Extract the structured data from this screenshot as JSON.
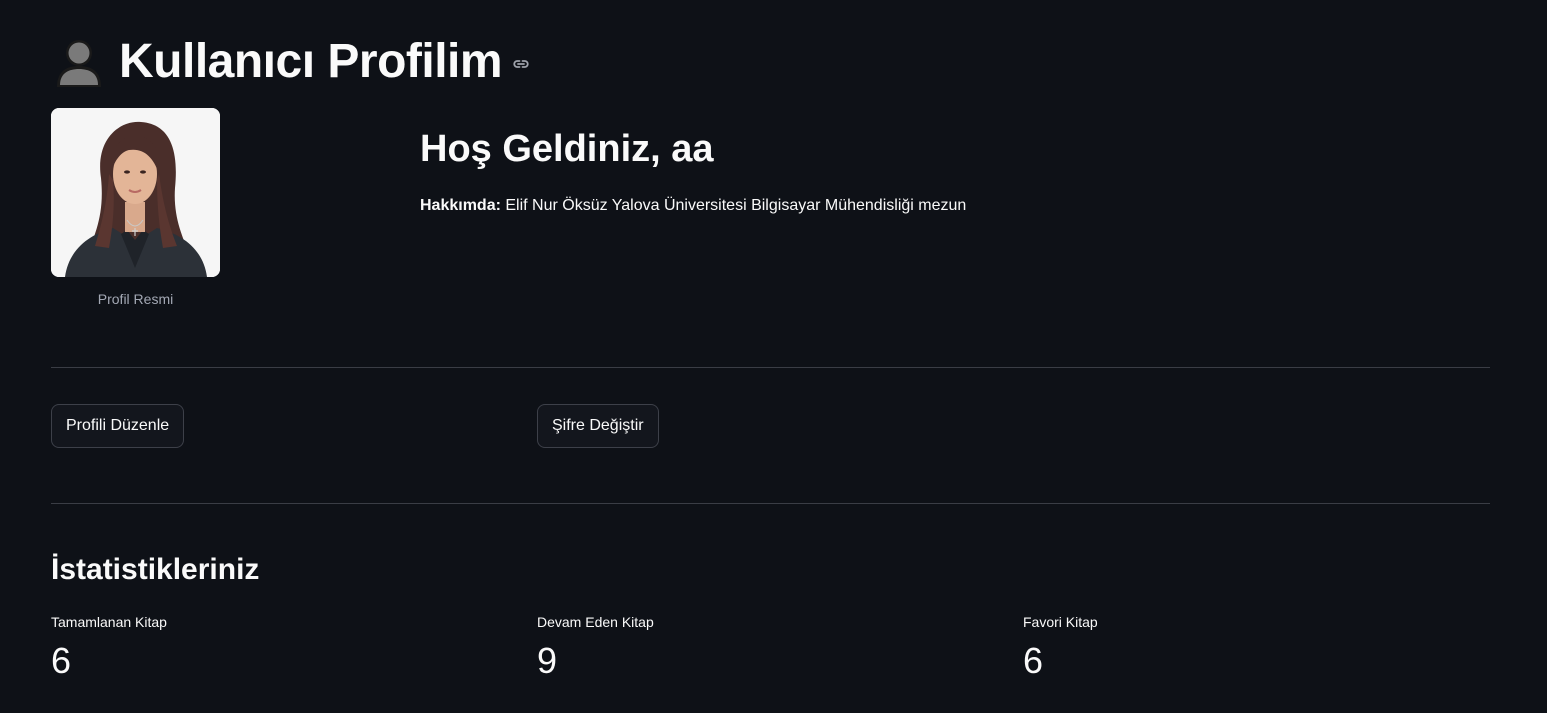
{
  "header": {
    "title": "Kullanıcı Profilim",
    "emoji_icon": "bust-in-silhouette-icon",
    "anchor_icon": "link-icon"
  },
  "profile": {
    "avatar_caption": "Profil Resmi",
    "welcome": "Hoş Geldiniz, aa",
    "about_label": "Hakkımda:",
    "about_text": " Elif Nur Öksüz Yalova Üniversitesi Bilgisayar Mühendisliği mezun"
  },
  "actions": {
    "edit_profile": "Profili Düzenle",
    "change_password": "Şifre Değiştir"
  },
  "stats": {
    "title": "İstatistikleriniz",
    "items": [
      {
        "label": "Tamamlanan Kitap",
        "value": "6"
      },
      {
        "label": "Devam Eden Kitap",
        "value": "9"
      },
      {
        "label": "Favori Kitap",
        "value": "6"
      }
    ]
  },
  "colors": {
    "background": "#0e1117",
    "text": "#fafafa",
    "muted": "#a3a8b4",
    "divider": "#3a3d45"
  }
}
